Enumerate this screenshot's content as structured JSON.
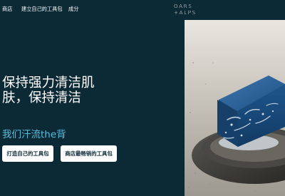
{
  "nav": {
    "shop": "商店",
    "build_kit": "建立自己的工具包",
    "ingredients": "成分"
  },
  "logo": {
    "line1": "OARS",
    "line2": "+ALPS"
  },
  "hero": {
    "headline": "保持强力清洁肌肤，保持清洁",
    "subhead": "我们汗流the背",
    "cta_build": "打造自己的工具包",
    "cta_bestsellers": "商店最畅销的工具包"
  },
  "colors": {
    "background": "#0c2a36",
    "accent": "#56c0de",
    "button_bg": "#ffffff"
  },
  "icons": {
    "hero_image": "blue-soap-bar-on-stone-dish-image"
  }
}
